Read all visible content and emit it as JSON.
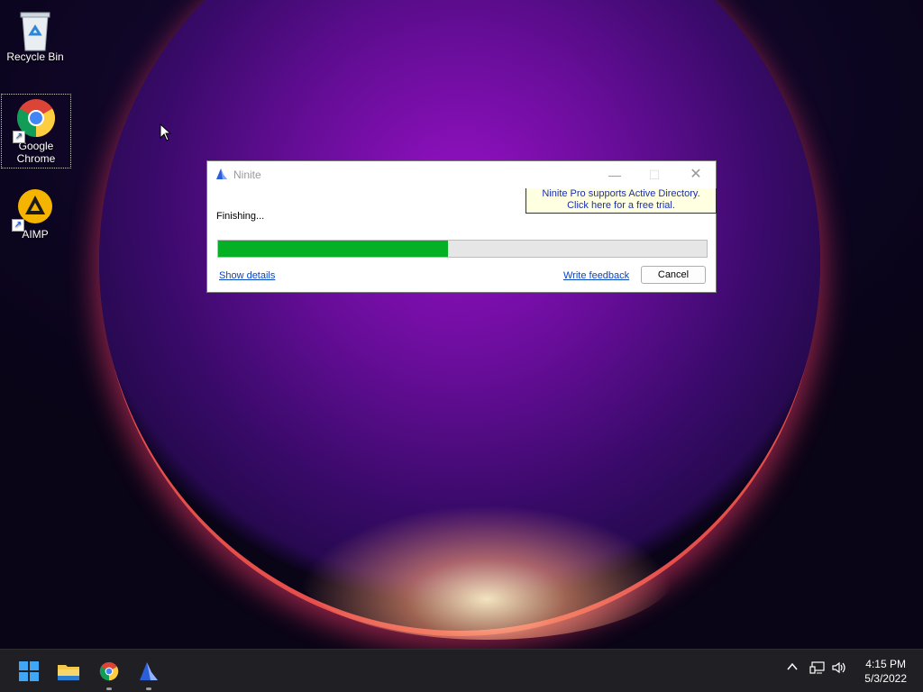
{
  "desktop": {
    "icons": [
      {
        "label": "Recycle Bin",
        "icon": "recycle-bin-icon"
      },
      {
        "label_line1": "Google",
        "label_line2": "Chrome",
        "icon": "chrome-icon"
      },
      {
        "label": "AIMP",
        "icon": "aimp-icon"
      }
    ]
  },
  "dialog": {
    "title": "Ninite",
    "promo_line1": "Ninite Pro supports Active Directory.",
    "promo_line2": "Click here for a free trial.",
    "status": "Finishing...",
    "progress_percent": 47,
    "show_details_label": "Show details",
    "write_feedback_label": "Write feedback",
    "cancel_label": "Cancel",
    "colors": {
      "progress_fill": "#06b025",
      "link": "#0645c6",
      "promo_bg": "#ffffe1"
    }
  },
  "taskbar": {
    "apps": [
      "start-icon",
      "file-explorer-icon",
      "chrome-icon",
      "ninite-icon"
    ],
    "tray_icons": [
      "chevron-up-icon",
      "network-icon",
      "volume-icon"
    ],
    "time": "4:15 PM",
    "date": "5/3/2022"
  }
}
